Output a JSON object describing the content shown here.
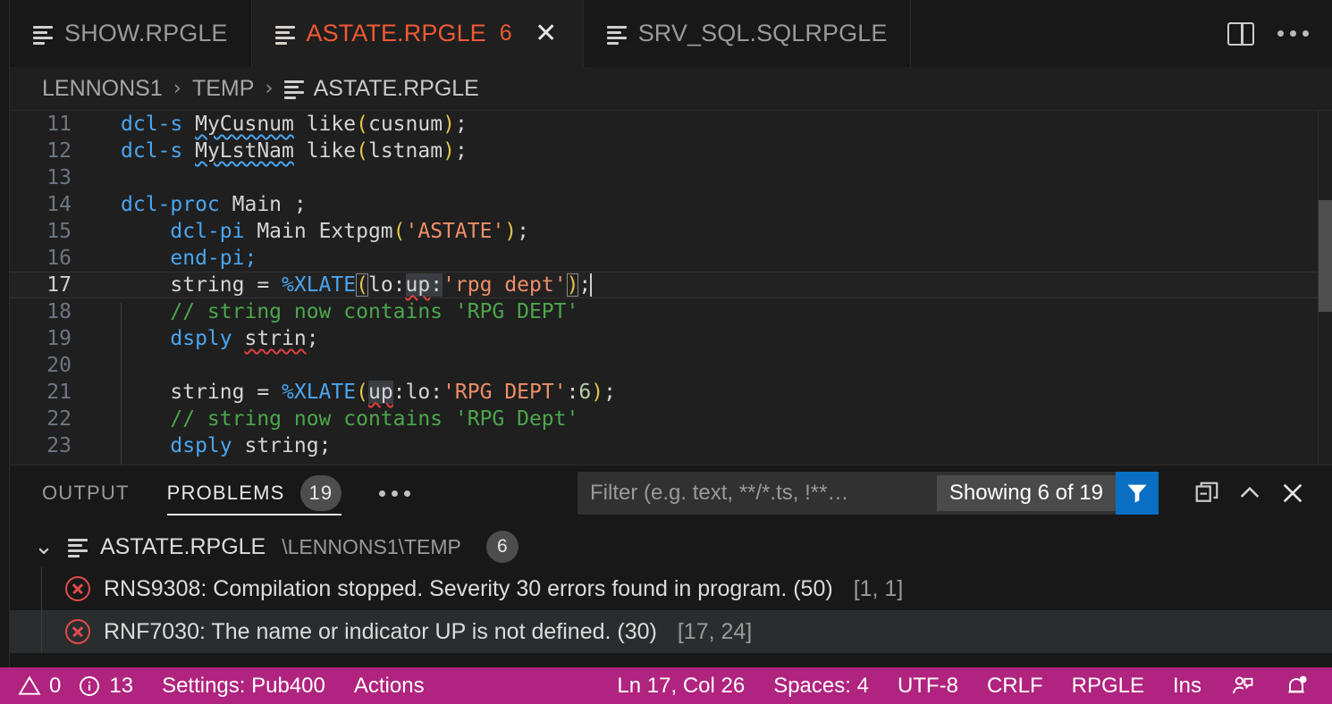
{
  "window": {
    "tabs": [
      {
        "label": "SHOW.RPGLE",
        "icon": "rpgle-file-icon",
        "active": false,
        "badge": "",
        "closable": false
      },
      {
        "label": "ASTATE.RPGLE",
        "icon": "rpgle-file-icon",
        "active": true,
        "badge": "6",
        "closable": true
      },
      {
        "label": "SRV_SQL.SQLRPGLE",
        "icon": "rpgle-file-icon",
        "active": false,
        "badge": "",
        "closable": false
      }
    ],
    "actions": [
      {
        "name": "split-editor-icon",
        "label": "Split Editor"
      },
      {
        "name": "more-actions-icon",
        "label": "More Actions..."
      }
    ]
  },
  "breadcrumb": {
    "items": [
      "LENNONS1",
      "TEMP",
      "ASTATE.RPGLE"
    ],
    "separator": "›"
  },
  "editor": {
    "language": "RPGLE",
    "current_line": 17,
    "lines": [
      {
        "n": "11",
        "tokens": [
          {
            "t": "dcl-s ",
            "c": "kw"
          },
          {
            "t": "MyCusnum",
            "c": "pln wavy-blue"
          },
          {
            "t": " like",
            "c": "pln"
          },
          {
            "t": "(",
            "c": "par"
          },
          {
            "t": "cusnum",
            "c": "pln"
          },
          {
            "t": ")",
            "c": "par"
          },
          {
            "t": ";",
            "c": "pln"
          }
        ]
      },
      {
        "n": "12",
        "tokens": [
          {
            "t": "dcl-s ",
            "c": "kw"
          },
          {
            "t": "MyLstNam",
            "c": "pln wavy-blue"
          },
          {
            "t": " like",
            "c": "pln"
          },
          {
            "t": "(",
            "c": "par"
          },
          {
            "t": "lstnam",
            "c": "pln"
          },
          {
            "t": ")",
            "c": "par"
          },
          {
            "t": ";",
            "c": "pln"
          }
        ]
      },
      {
        "n": "13",
        "tokens": []
      },
      {
        "n": "14",
        "tokens": [
          {
            "t": "dcl-proc ",
            "c": "kw"
          },
          {
            "t": "Main ;",
            "c": "pln"
          }
        ]
      },
      {
        "n": "15",
        "tokens": [
          {
            "t": "    dcl-pi ",
            "c": "kw"
          },
          {
            "t": "Main Extpgm",
            "c": "pln"
          },
          {
            "t": "(",
            "c": "par"
          },
          {
            "t": "'ASTATE'",
            "c": "str"
          },
          {
            "t": ")",
            "c": "par"
          },
          {
            "t": ";",
            "c": "pln"
          }
        ]
      },
      {
        "n": "16",
        "tokens": [
          {
            "t": "    end-pi;",
            "c": "kw"
          }
        ]
      },
      {
        "n": "17",
        "tokens": [
          {
            "t": "    string = ",
            "c": "pln"
          },
          {
            "t": "%XLATE",
            "c": "fn"
          },
          {
            "t": "(",
            "c": "par bracket"
          },
          {
            "t": "lo:",
            "c": "pln"
          },
          {
            "t": "up",
            "c": "pln sel wavy-red"
          },
          {
            "t": ":",
            "c": "pln sel"
          },
          {
            "t": "'rpg dept'",
            "c": "str"
          },
          {
            "t": ")",
            "c": "par bracket"
          },
          {
            "t": ";",
            "c": "pln"
          }
        ]
      },
      {
        "n": "18",
        "tokens": [
          {
            "t": "    // string now contains 'RPG DEPT'",
            "c": "cmt"
          }
        ]
      },
      {
        "n": "19",
        "tokens": [
          {
            "t": "    dsply ",
            "c": "kw"
          },
          {
            "t": "strin",
            "c": "pln wavy-red"
          },
          {
            "t": ";",
            "c": "pln"
          }
        ]
      },
      {
        "n": "20",
        "tokens": []
      },
      {
        "n": "21",
        "tokens": [
          {
            "t": "    string = ",
            "c": "pln"
          },
          {
            "t": "%XLATE",
            "c": "fn"
          },
          {
            "t": "(",
            "c": "par"
          },
          {
            "t": "up",
            "c": "pln sel wavy-red"
          },
          {
            "t": ":lo",
            "c": "pln"
          },
          {
            "t": ":",
            "c": "pln"
          },
          {
            "t": "'RPG DEPT'",
            "c": "str"
          },
          {
            "t": ":",
            "c": "pln"
          },
          {
            "t": "6",
            "c": "num"
          },
          {
            "t": ")",
            "c": "par"
          },
          {
            "t": ";",
            "c": "pln"
          }
        ]
      },
      {
        "n": "22",
        "tokens": [
          {
            "t": "    // string now contains 'RPG Dept'",
            "c": "cmt"
          }
        ]
      },
      {
        "n": "23",
        "tokens": [
          {
            "t": "    dsply ",
            "c": "kw"
          },
          {
            "t": "string;",
            "c": "pln"
          }
        ]
      }
    ]
  },
  "panel": {
    "tabs": [
      {
        "label": "OUTPUT",
        "active": false,
        "badge": ""
      },
      {
        "label": "PROBLEMS",
        "active": true,
        "badge": "19"
      }
    ],
    "more_label": "Views and More Actions...",
    "filter": {
      "value": "",
      "placeholder": "Filter (e.g. text, **/*.ts, !**…"
    },
    "showing": "Showing 6 of 19",
    "filter_button": "filter-icon",
    "toolbar": [
      {
        "name": "view-as-table-icon"
      },
      {
        "name": "collapse-panel-icon"
      },
      {
        "name": "close-panel-icon"
      }
    ],
    "file_group": {
      "expanded": true,
      "name": "ASTATE.RPGLE",
      "path": "\\LENNONS1\\TEMP",
      "count": "6"
    },
    "problems": [
      {
        "severity": "error",
        "message": "RNS9308: Compilation stopped. Severity 30 errors found in program. (50)",
        "position": "[1, 1]",
        "hover": false
      },
      {
        "severity": "error",
        "message": "RNF7030: The name or indicator UP is not defined. (30)",
        "position": "[17, 24]",
        "hover": true
      }
    ]
  },
  "statusbar": {
    "background": "#b0237e",
    "left": [
      {
        "name": "warnings-count",
        "icon": "warning-icon",
        "text": "0"
      },
      {
        "name": "info-count",
        "icon": "info-icon",
        "text": "13"
      },
      {
        "name": "settings-connection",
        "text": "Settings: Pub400"
      },
      {
        "name": "actions",
        "text": "Actions"
      }
    ],
    "right": [
      {
        "name": "cursor-position",
        "text": "Ln 17, Col 26"
      },
      {
        "name": "indentation",
        "text": "Spaces: 4"
      },
      {
        "name": "encoding",
        "text": "UTF-8"
      },
      {
        "name": "eol",
        "text": "CRLF"
      },
      {
        "name": "language-mode",
        "text": "RPGLE"
      },
      {
        "name": "insert-mode",
        "text": "Ins"
      },
      {
        "name": "live-share",
        "icon": "live-share-icon",
        "text": ""
      },
      {
        "name": "notifications",
        "icon": "bell-icon",
        "text": ""
      }
    ]
  }
}
